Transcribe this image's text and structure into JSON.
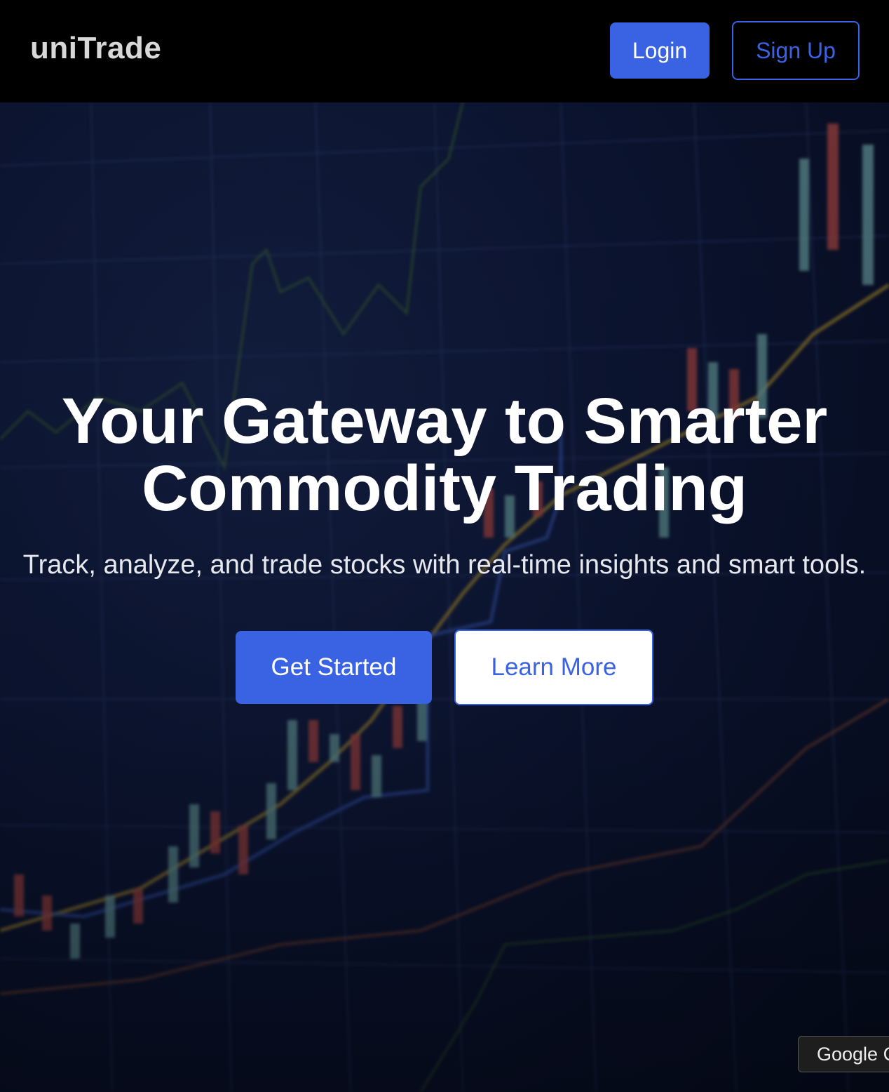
{
  "navbar": {
    "brand": "uniTrade",
    "login_label": "Login",
    "signup_label": "Sign Up"
  },
  "hero": {
    "title_line1": "Your Gateway to Smarter",
    "title_line2": "Commodity Trading",
    "subtitle": "Track, analyze, and trade stocks with real-time insights and smart tools.",
    "primary_cta": "Get Started",
    "secondary_cta": "Learn More"
  },
  "overlay": {
    "google_tag": "Google C"
  },
  "colors": {
    "accent": "#3a63e3",
    "navbar_bg": "#000000",
    "hero_bg": "#0c1533"
  }
}
